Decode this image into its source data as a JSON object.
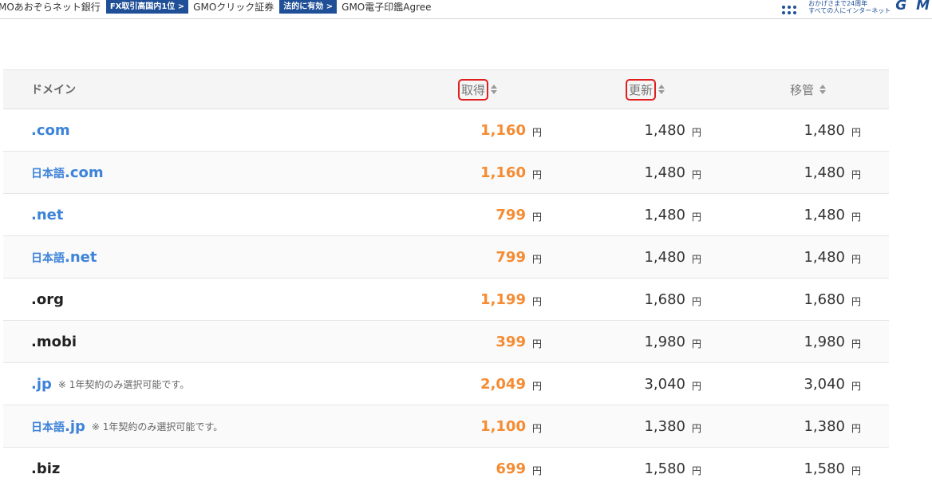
{
  "topbar": {
    "links": [
      {
        "badge": "",
        "text": "MOあおぞらネット銀行"
      },
      {
        "badge": "FX取引高国内1位 >",
        "text": "GMOクリック証券"
      },
      {
        "badge": "法的に有効 >",
        "text": "GMO電子印鑑Agree"
      }
    ],
    "slogan_line1": "おかげさまで24周年",
    "slogan_line2": "すべての人にインターネット",
    "logo_text": "G M",
    "brand_color": "#1f4f96"
  },
  "table": {
    "headers": {
      "domain": "ドメイン",
      "acquire": "取得",
      "renew": "更新",
      "transfer": "移管"
    },
    "currency": "円",
    "rows": [
      {
        "prefix": "",
        "name": ".com",
        "note": "",
        "color": "blue",
        "acquire": "1,160",
        "renew": "1,480",
        "transfer": "1,480"
      },
      {
        "prefix": "日本語",
        "name": ".com",
        "note": "",
        "color": "blue",
        "acquire": "1,160",
        "renew": "1,480",
        "transfer": "1,480"
      },
      {
        "prefix": "",
        "name": ".net",
        "note": "",
        "color": "blue",
        "acquire": "799",
        "renew": "1,480",
        "transfer": "1,480"
      },
      {
        "prefix": "日本語",
        "name": ".net",
        "note": "",
        "color": "blue",
        "acquire": "799",
        "renew": "1,480",
        "transfer": "1,480"
      },
      {
        "prefix": "",
        "name": ".org",
        "note": "",
        "color": "black",
        "acquire": "1,199",
        "renew": "1,680",
        "transfer": "1,680"
      },
      {
        "prefix": "",
        "name": ".mobi",
        "note": "",
        "color": "black",
        "acquire": "399",
        "renew": "1,980",
        "transfer": "1,980"
      },
      {
        "prefix": "",
        "name": ".jp",
        "note": "※ 1年契約のみ選択可能です。",
        "color": "blue",
        "acquire": "2,049",
        "renew": "3,040",
        "transfer": "3,040"
      },
      {
        "prefix": "日本語",
        "name": ".jp",
        "note": "※ 1年契約のみ選択可能です。",
        "color": "blue",
        "acquire": "1,100",
        "renew": "1,380",
        "transfer": "1,380"
      },
      {
        "prefix": "",
        "name": ".biz",
        "note": "",
        "color": "black",
        "acquire": "699",
        "renew": "1,580",
        "transfer": "1,580"
      }
    ],
    "acquire_color": "#f58b32",
    "link_color": "#3d83d9"
  }
}
